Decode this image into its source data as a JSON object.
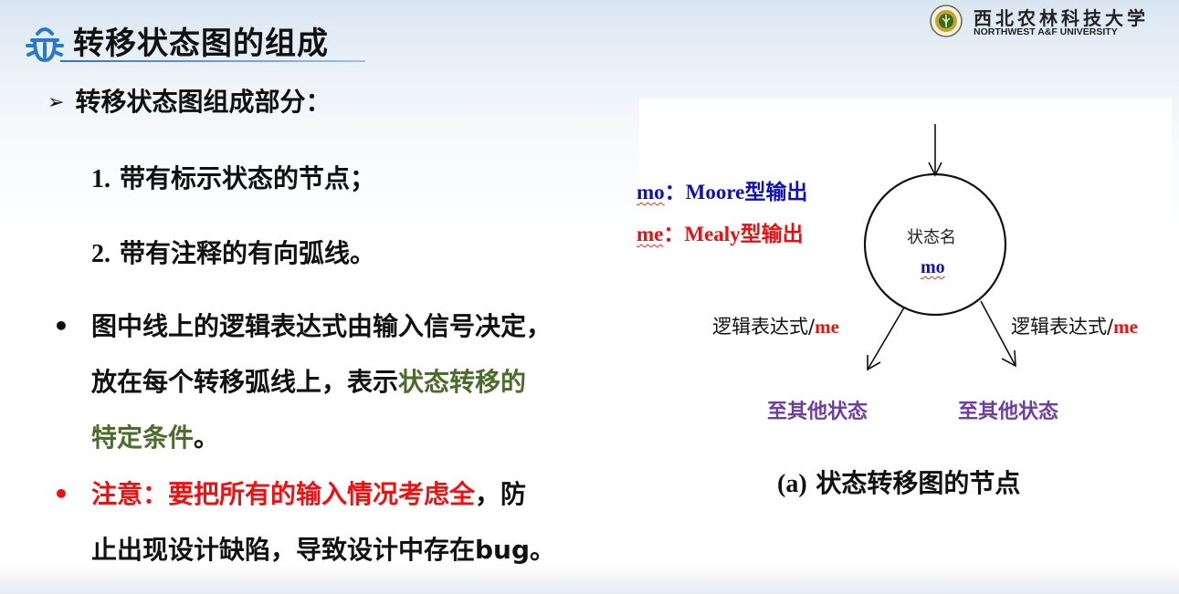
{
  "header": {
    "title": "转移状态图的组成",
    "icon": "bug-icon"
  },
  "logo": {
    "name_cn": "西北农林科技大学",
    "name_en": "NORTHWEST A&F UNIVERSITY",
    "emblem": "university-emblem"
  },
  "content": {
    "heading_marker": "➢",
    "heading": "转移状态图组成部分：",
    "items": [
      {
        "num": "1.",
        "text": "带有标示状态的节点；"
      },
      {
        "num": "2.",
        "text": "带有注释的有向弧线。"
      }
    ],
    "bullet1": {
      "marker": "•",
      "line1": "图中线上的逻辑表达式由输入信号决定，",
      "line2": "放在每个转移弧线上，表示",
      "line2_highlight": "状态转移的",
      "line3_highlight": "特定条件",
      "line3_end": "。"
    },
    "bullet2": {
      "marker": "•",
      "red_part": "注意：要把所有的输入情况考虑全",
      "line1_end": "，防",
      "line2": "止出现设计缺陷，导致设计中存在bug。"
    }
  },
  "diagram": {
    "legend_mo_key": "mo",
    "legend_mo_text": "：Moore型输出",
    "legend_me_key": "me",
    "legend_me_text": "：Mealy型输出",
    "state_name": "状态名",
    "state_output": "mo",
    "left_edge_expr": "逻辑表达式/",
    "left_edge_out": "me",
    "right_edge_expr": "逻辑表达式/",
    "right_edge_out": "me",
    "left_target": "至其他状态",
    "right_target": "至其他状态",
    "caption_label": "(a)",
    "caption_text": "状态转移图的节点"
  },
  "colors": {
    "accent_blue": "#1010b8",
    "alert_red": "#ee1111",
    "highlight_green": "#4e6b2e",
    "target_purple": "#6e3fa3",
    "icon_blue": "#2a78c8"
  }
}
